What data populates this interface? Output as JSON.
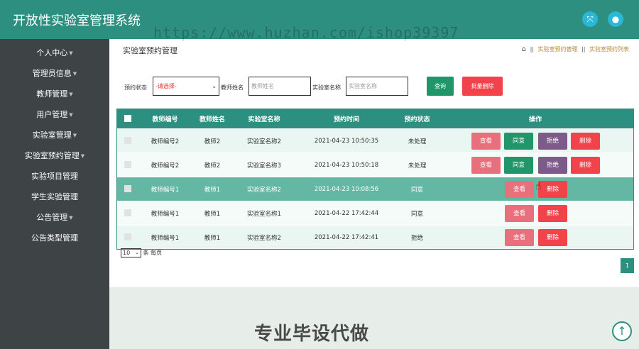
{
  "header": {
    "app_title": "开放性实验室管理系统",
    "fullscreen_icon": "expand-icon",
    "user_icon": "user-icon"
  },
  "watermark": "https://www.huzhan.com/ishop39397",
  "sidebar": {
    "items": [
      {
        "label": "个人中心",
        "has_caret": true
      },
      {
        "label": "管理员信息",
        "has_caret": true
      },
      {
        "label": "教师管理",
        "has_caret": true
      },
      {
        "label": "用户管理",
        "has_caret": true
      },
      {
        "label": "实验室管理",
        "has_caret": true
      },
      {
        "label": "实验室预约管理",
        "has_caret": true
      },
      {
        "label": "实验项目管理",
        "has_caret": false
      },
      {
        "label": "学生实验管理",
        "has_caret": false
      },
      {
        "label": "公告管理",
        "has_caret": true
      },
      {
        "label": "公告类型管理",
        "has_caret": false
      }
    ]
  },
  "page": {
    "title": "实验室预约管理",
    "breadcrumb": {
      "sep": "||",
      "level1": "实验室预约管理",
      "level2": "实验室预约列表"
    }
  },
  "filters": {
    "status_label": "预约状态",
    "status_value": "-请选择-",
    "teacher_label": "教师姓名",
    "teacher_placeholder": "教师姓名",
    "lab_label": "实验室名称",
    "lab_placeholder": "实验室名称",
    "query_button": "查询",
    "batch_delete_button": "批量删除"
  },
  "table": {
    "headers": {
      "teacher_no": "教师编号",
      "teacher_name": "教师姓名",
      "lab_name": "实验室名称",
      "time": "预约时间",
      "status": "预约状态",
      "actions": "操作"
    },
    "rows": [
      {
        "teacher_no": "教师编号2",
        "teacher_name": "教师2",
        "lab_name": "实验室名称2",
        "time": "2021-04-23 10:50:35",
        "status": "未处理"
      },
      {
        "teacher_no": "教师编号2",
        "teacher_name": "教师2",
        "lab_name": "实验室名称3",
        "time": "2021-04-23 10:50:18",
        "status": "未处理"
      },
      {
        "teacher_no": "教师编号1",
        "teacher_name": "教师1",
        "lab_name": "实验室名称2",
        "time": "2021-04-23 10:08:56",
        "status": "同意"
      },
      {
        "teacher_no": "教师编号1",
        "teacher_name": "教师1",
        "lab_name": "实验室名称1",
        "time": "2021-04-22 17:42:44",
        "status": "同意"
      },
      {
        "teacher_no": "教师编号1",
        "teacher_name": "教师1",
        "lab_name": "实验室名称2",
        "time": "2021-04-22 17:42:41",
        "status": "拒绝"
      }
    ],
    "actions": {
      "view": "查看",
      "agree": "同意",
      "reject": "拒绝",
      "delete": "删除"
    }
  },
  "pagination": {
    "page_size": "10",
    "per_page_text": "条 每页",
    "current_page": "1"
  },
  "footer": {
    "promo_text": "专业毕设代做",
    "scroll_top_icon": "arrow-up-icon"
  }
}
